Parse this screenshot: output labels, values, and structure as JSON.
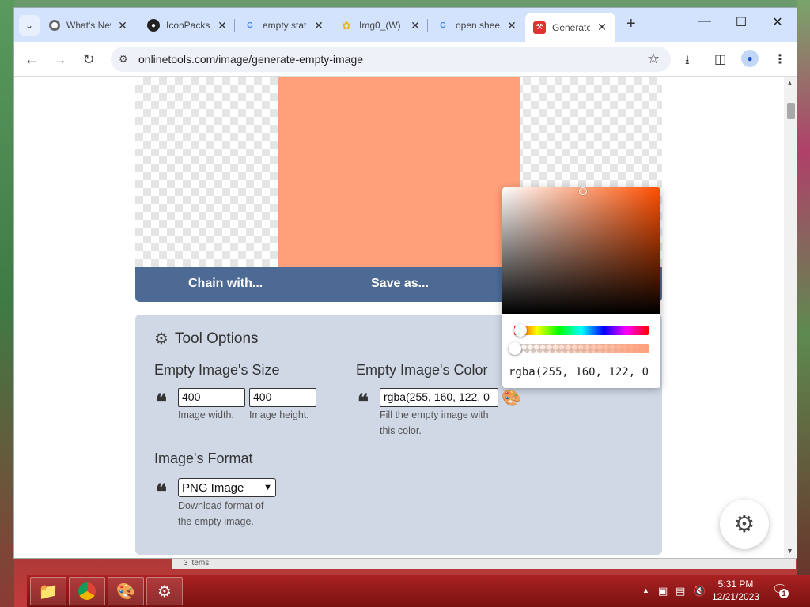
{
  "tabs": [
    {
      "title": "What's New",
      "icon": "chrome-icon"
    },
    {
      "title": "IconPacks",
      "icon": "github-icon"
    },
    {
      "title": "empty state",
      "icon": "google-icon"
    },
    {
      "title": "Img0_(W)",
      "icon": "flower-icon"
    },
    {
      "title": "open sheet",
      "icon": "google-icon"
    },
    {
      "title": "Generate",
      "icon": "onlinetools-icon"
    }
  ],
  "address_bar": {
    "url": "onlinetools.com/image/generate-empty-image"
  },
  "preview": {
    "fill_color": "#ffa07a"
  },
  "actions": {
    "chain_label": "Chain with...",
    "save_label": "Save as..."
  },
  "tool_options": {
    "title": "Tool Options",
    "size_title": "Empty Image's Size",
    "width_value": "400",
    "width_help": "Image width.",
    "height_value": "400",
    "height_help": "Image height.",
    "color_title": "Empty Image's Color",
    "color_value": "rgba(255, 160, 122, 0",
    "color_help_1": "Fill the empty image with",
    "color_help_2": "this color.",
    "format_title": "Image's Format",
    "format_value": "PNG Image",
    "format_help_1": "Download format of",
    "format_help_2": "the empty image."
  },
  "color_picker": {
    "value_text": "rgba(255, 160, 122, 0",
    "hue_color": "#ff4e00",
    "alpha_fraction": 0.0
  },
  "behind_window": {
    "status_text": "3 items"
  },
  "taskbar": {
    "time": "5:31 PM",
    "date": "12/21/2023",
    "notification_count": "1"
  },
  "colors": {
    "tabstrip": "#d3e3fd",
    "action_bar": "#4d6a95",
    "options_panel": "#d0d8e6",
    "taskbar": "#7a1010"
  }
}
